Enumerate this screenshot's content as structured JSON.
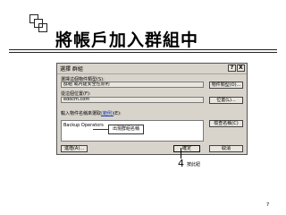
{
  "slide": {
    "title": "將帳戶加入群組中",
    "step_number": "4",
    "step_text": "按此鈕",
    "page_number": "7"
  },
  "dialog": {
    "title": "選擇 群組",
    "help_button": "?",
    "close_button": "X",
    "object_type_label": "選擇這個物件類型(S):",
    "object_type_value": "群組 或內建安全性原則",
    "object_type_button": "物件類型(O)...",
    "location_label": "從這個位置(F):",
    "location_value": "edocm.com",
    "location_button": "位置(L)...",
    "names_label_prefix": "輸入物件名稱來選取",
    "names_label_link": "(範例)",
    "names_label_suffix": "(E):",
    "names_value": "Backup Operators",
    "check_names_button": "檢查名稱(C)",
    "advanced_button": "進階(A)...",
    "ok_button": "確定",
    "cancel_button": "取消"
  },
  "callout": {
    "text": "出現群組名稱"
  }
}
